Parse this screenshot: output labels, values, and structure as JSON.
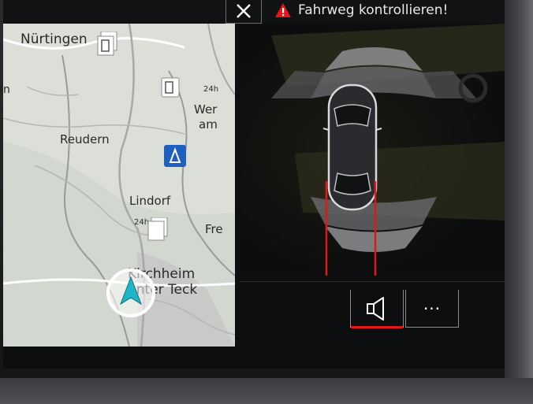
{
  "header": {
    "close_icon": "close-icon",
    "warning_icon": "warning-triangle-icon",
    "warning_text": "Fahrweg kontrollieren!",
    "warning_color": "#e3161b"
  },
  "map": {
    "places": {
      "nuertingen": "Nürtingen",
      "reudern": "Reudern",
      "lindorf": "Lindorf",
      "kirchheim_1": "Kirchheim",
      "kirchheim_2": "unter Teck",
      "wer_1": "Wer",
      "wer_2": "am",
      "fre": "Fre",
      "n_edge": "n"
    },
    "badges": {
      "h24_top": "24h",
      "h24_bottom": "24h"
    },
    "icons": [
      "fuel-pump-icon",
      "parking-icon",
      "navigation-arrow-icon"
    ]
  },
  "parking": {
    "car_icon": "car-top-view-icon",
    "sensor_color": "#9a9c9f",
    "guide_line_color": "#e3161b"
  },
  "controls": {
    "sound_icon": "speaker-icon",
    "more_label": "···",
    "active_color": "#e3161b"
  }
}
